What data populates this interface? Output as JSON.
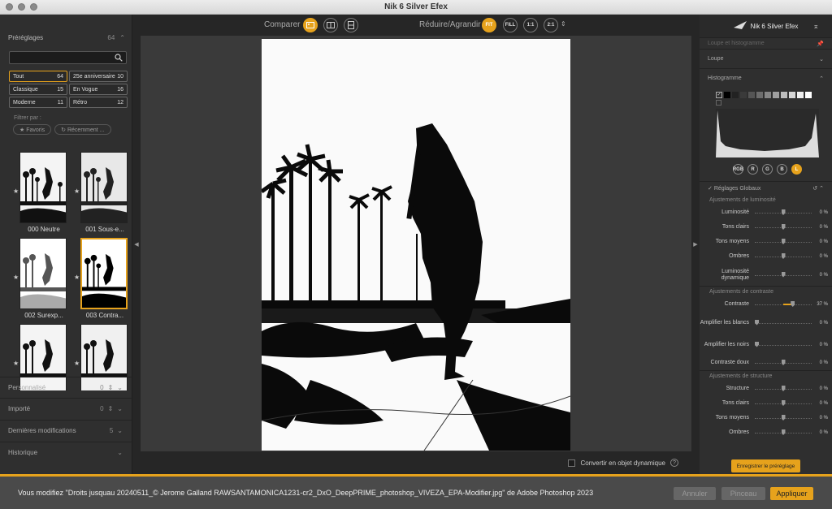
{
  "window": {
    "title": "Nik 6 Silver Efex"
  },
  "left": {
    "presets_label": "Préréglages",
    "presets_count": "64",
    "search": {
      "placeholder": "",
      "value": ""
    },
    "categories": [
      {
        "label": "Tout",
        "count": "64"
      },
      {
        "label": "25e anniversaire",
        "count": "10"
      },
      {
        "label": "Classique",
        "count": "15"
      },
      {
        "label": "En Vogue",
        "count": "16"
      },
      {
        "label": "Moderne",
        "count": "11"
      },
      {
        "label": "Rétro",
        "count": "12"
      }
    ],
    "filter_label": "Filtrer par :",
    "chips": [
      "★ Favoris",
      "↻ Récemment ..."
    ],
    "thumbs": [
      "000 Neutre",
      "001 Sous-e...",
      "002 Surexp...",
      "003 Contra...",
      "",
      ""
    ],
    "sections": [
      {
        "label": "Personnalisé",
        "count": "0"
      },
      {
        "label": "Importé",
        "count": "0"
      },
      {
        "label": "Dernières modifications",
        "count": "5"
      },
      {
        "label": "Historique",
        "count": ""
      }
    ]
  },
  "toolbar": {
    "compare": "Comparer",
    "resize": "Réduire/Agrandir",
    "fit": "FIT",
    "fill": "FILL",
    "one": "1:1",
    "two": "2:1"
  },
  "bottom": {
    "convert": "Convertir en objet dynamique",
    "help": "?"
  },
  "right": {
    "brand": "Nik 6 Silver Efex",
    "loupe_hist": "Loupe et histogramme",
    "loupe": "Loupe",
    "histogramme": "Histogramme",
    "channels": [
      "RGB",
      "R",
      "G",
      "B",
      "L"
    ],
    "global": "Réglages Globaux",
    "groups": [
      {
        "title": "Ajustements de luminosité",
        "sliders": [
          {
            "name": "Luminosité",
            "value": "0 %",
            "pos": 0.5
          },
          {
            "name": "Tons clairs",
            "value": "0 %",
            "pos": 0.5
          },
          {
            "name": "Tons moyens",
            "value": "0 %",
            "pos": 0.5
          },
          {
            "name": "Ombres",
            "value": "0 %",
            "pos": 0.5
          },
          {
            "name": "Luminosité dynamique",
            "value": "0 %",
            "pos": 0.5
          }
        ]
      },
      {
        "title": "Ajustements de contraste",
        "sliders": [
          {
            "name": "Contraste",
            "value": "37 %",
            "pos": 0.68
          },
          {
            "name": "Amplifier les blancs",
            "value": "0 %",
            "pos": 0.0
          },
          {
            "name": "Amplifier les noirs",
            "value": "0 %",
            "pos": 0.0
          },
          {
            "name": "Contraste doux",
            "value": "0 %",
            "pos": 0.5
          }
        ]
      },
      {
        "title": "Ajustements de structure",
        "sliders": [
          {
            "name": "Structure",
            "value": "0 %",
            "pos": 0.5
          },
          {
            "name": "Tons clairs",
            "value": "0 %",
            "pos": 0.5
          },
          {
            "name": "Tons moyens",
            "value": "0 %",
            "pos": 0.5
          },
          {
            "name": "Ombres",
            "value": "0 %",
            "pos": 0.5
          }
        ]
      }
    ],
    "save": "Enregistrer le préréglage"
  },
  "footer": {
    "message": "Vous modifiez \"Droits jusquau 20240511_© Jerome Galland RAWSANTAMONICA1231-cr2_DxO_DeepPRIME_photoshop_VIVEZA_EPA-Modifier.jpg\" de Adobe Photoshop 2023",
    "cancel": "Annuler",
    "brush": "Pinceau",
    "apply": "Appliquer"
  },
  "colors": {
    "accent": "#e6a21c"
  }
}
